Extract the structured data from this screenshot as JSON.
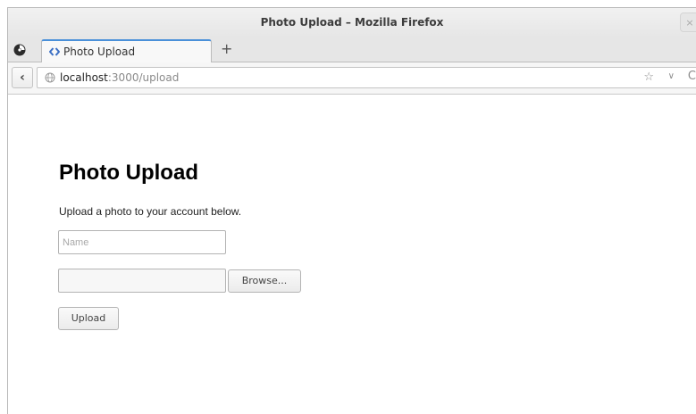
{
  "window": {
    "title": "Photo Upload – Mozilla Firefox",
    "close_glyph": "×"
  },
  "tabs": [
    {
      "label": "Photo Upload",
      "favicon": "code-brackets-icon",
      "active": true
    }
  ],
  "tabstrip": {
    "new_tab_glyph": "+"
  },
  "navbar": {
    "back_glyph": "‹",
    "url_host": "localhost",
    "url_path": ":3000/upload",
    "star_glyph": "☆",
    "dropdown_glyph": "∨",
    "reload_glyph": "C"
  },
  "page": {
    "title": "Photo Upload",
    "description": "Upload a photo to your account below.",
    "name_field": {
      "placeholder": "Name",
      "value": ""
    },
    "browse_label": "Browse...",
    "upload_label": "Upload"
  },
  "colors": {
    "tab_accent": "#4a90d9",
    "favicon": "#3b6fc4"
  }
}
